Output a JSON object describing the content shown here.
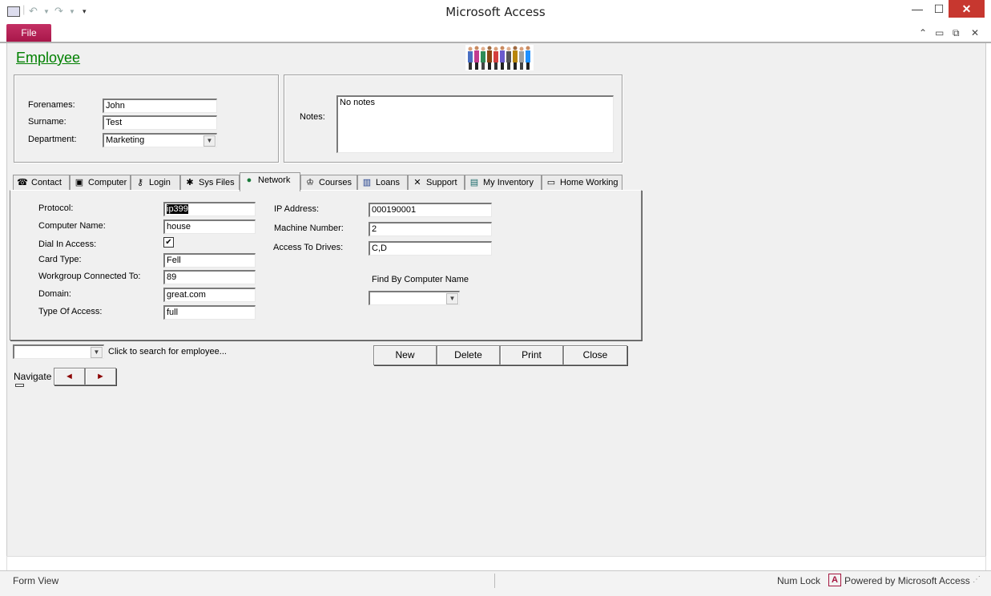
{
  "window": {
    "title": "Microsoft Access",
    "file_tab": "File",
    "qat": {
      "app_icon": "form-icon",
      "undo": "undo-icon",
      "redo": "redo-icon",
      "customize": "dropdown-icon"
    },
    "controls": {
      "minimize": "minimize-icon",
      "maximize": "maximize-icon",
      "close": "close-icon"
    },
    "ribbon_controls": {
      "collapse": "chevron-up-icon",
      "min": "minimize-icon",
      "restore": "restore-icon",
      "close": "close-icon"
    }
  },
  "form": {
    "heading": "Employee",
    "header_image": "people-group-image",
    "fields": {
      "forenames_label": "Forenames:",
      "forenames_value": "John",
      "surname_label": "Surname:",
      "surname_value": "Test",
      "department_label": "Department:",
      "department_value": "Marketing",
      "notes_label": "Notes:",
      "notes_value": "No notes"
    },
    "tabs": [
      {
        "label": "Contact",
        "icon": "telephone-icon"
      },
      {
        "label": "Computer",
        "icon": "floppy-disk-icon"
      },
      {
        "label": "Login",
        "icon": "key-icon"
      },
      {
        "label": "Sys Files",
        "icon": "sys-files-icon"
      },
      {
        "label": "Network",
        "icon": "globe-icon"
      },
      {
        "label": "Courses",
        "icon": "courses-icon"
      },
      {
        "label": "Loans",
        "icon": "book-icon"
      },
      {
        "label": "Support",
        "icon": "tools-icon"
      },
      {
        "label": "My Inventory",
        "icon": "inventory-icon"
      },
      {
        "label": "Home Working",
        "icon": "home-working-icon"
      }
    ],
    "active_tab": "Network",
    "network": {
      "protocol_label": "Protocol:",
      "protocol_value": "ip399",
      "computer_name_label": "Computer Name:",
      "computer_name_value": "house",
      "dial_in_label": "Dial In Access:",
      "dial_in_checked": "✔",
      "card_type_label": "Card Type:",
      "card_type_value": "Fell",
      "workgroup_label": "Workgroup Connected To:",
      "workgroup_value": "89",
      "domain_label": "Domain:",
      "domain_value": "great.com",
      "type_access_label": "Type Of Access:",
      "type_access_value": "full",
      "ip_label": "IP Address:",
      "ip_value": "000190001",
      "machine_label": "Machine Number:",
      "machine_value": "2",
      "drives_label": "Access To Drives:",
      "drives_value": "C,D",
      "find_label": "Find By Computer Name",
      "find_value": ""
    },
    "search": {
      "value": "",
      "hint": "Click to search for employee..."
    },
    "buttons": {
      "new": "New",
      "delete": "Delete",
      "print": "Print",
      "close": "Close"
    },
    "navigate": {
      "label": "Navigate",
      "prev": "◄",
      "next": "►"
    }
  },
  "statusbar": {
    "view": "Form View",
    "num_lock": "Num Lock",
    "powered": "Powered by Microsoft Access",
    "access_badge": "A"
  },
  "colors": {
    "heading": "#008000",
    "file_tab": "#b41f54",
    "close_button": "#c7372f"
  }
}
